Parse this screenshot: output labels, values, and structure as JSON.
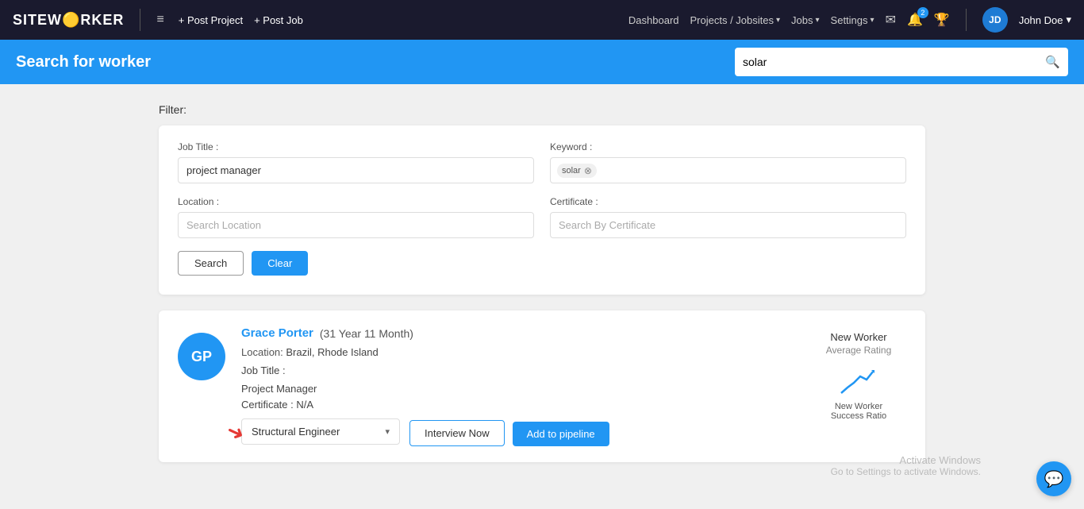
{
  "nav": {
    "logo_text": "SITEW",
    "logo_highlight": "O",
    "logo_rest": "RKER",
    "hamburger_icon": "≡",
    "post_project": "+ Post Project",
    "post_job": "+ Post Job",
    "links": [
      {
        "label": "Dashboard",
        "has_chevron": false
      },
      {
        "label": "Projects / Jobsites",
        "has_chevron": true
      },
      {
        "label": "Jobs",
        "has_chevron": true
      },
      {
        "label": "Settings",
        "has_chevron": true
      }
    ],
    "mail_icon": "✉",
    "bell_icon": "🔔",
    "trophy_icon": "🏆",
    "notification_count": "2",
    "avatar_initials": "JD",
    "user_name": "John Doe"
  },
  "header": {
    "title": "Search for worker",
    "search_placeholder": "solar",
    "search_value": "solar"
  },
  "filter": {
    "section_label": "Filter:",
    "job_title_label": "Job Title :",
    "job_title_value": "project manager",
    "keyword_label": "Keyword :",
    "keyword_value": "solar",
    "location_label": "Location :",
    "location_placeholder": "Search Location",
    "certificate_label": "Certificate :",
    "certificate_placeholder": "Search By Certificate",
    "search_btn": "Search",
    "clear_btn": "Clear"
  },
  "worker": {
    "initials": "GP",
    "name": "Grace Porter",
    "age": "(31 Year 11 Month)",
    "location_label": "Location:",
    "location_value": "Brazil, Rhode Island",
    "job_title_label": "Job Title :",
    "job_title_value": "Project Manager",
    "certificate_label": "Certificate :",
    "certificate_value": "N/A",
    "rating_title": "New Worker",
    "rating_sub": "Average Rating",
    "dropdown_value": "Structural Engineer",
    "interview_btn": "Interview Now",
    "pipeline_btn": "Add to pipeline",
    "success_ratio_label": "New Worker\nSuccess Ratio"
  },
  "activate": {
    "line1": "Activate Windows",
    "line2": "Go to Settings to activate Windows."
  },
  "chat_icon": "💬"
}
